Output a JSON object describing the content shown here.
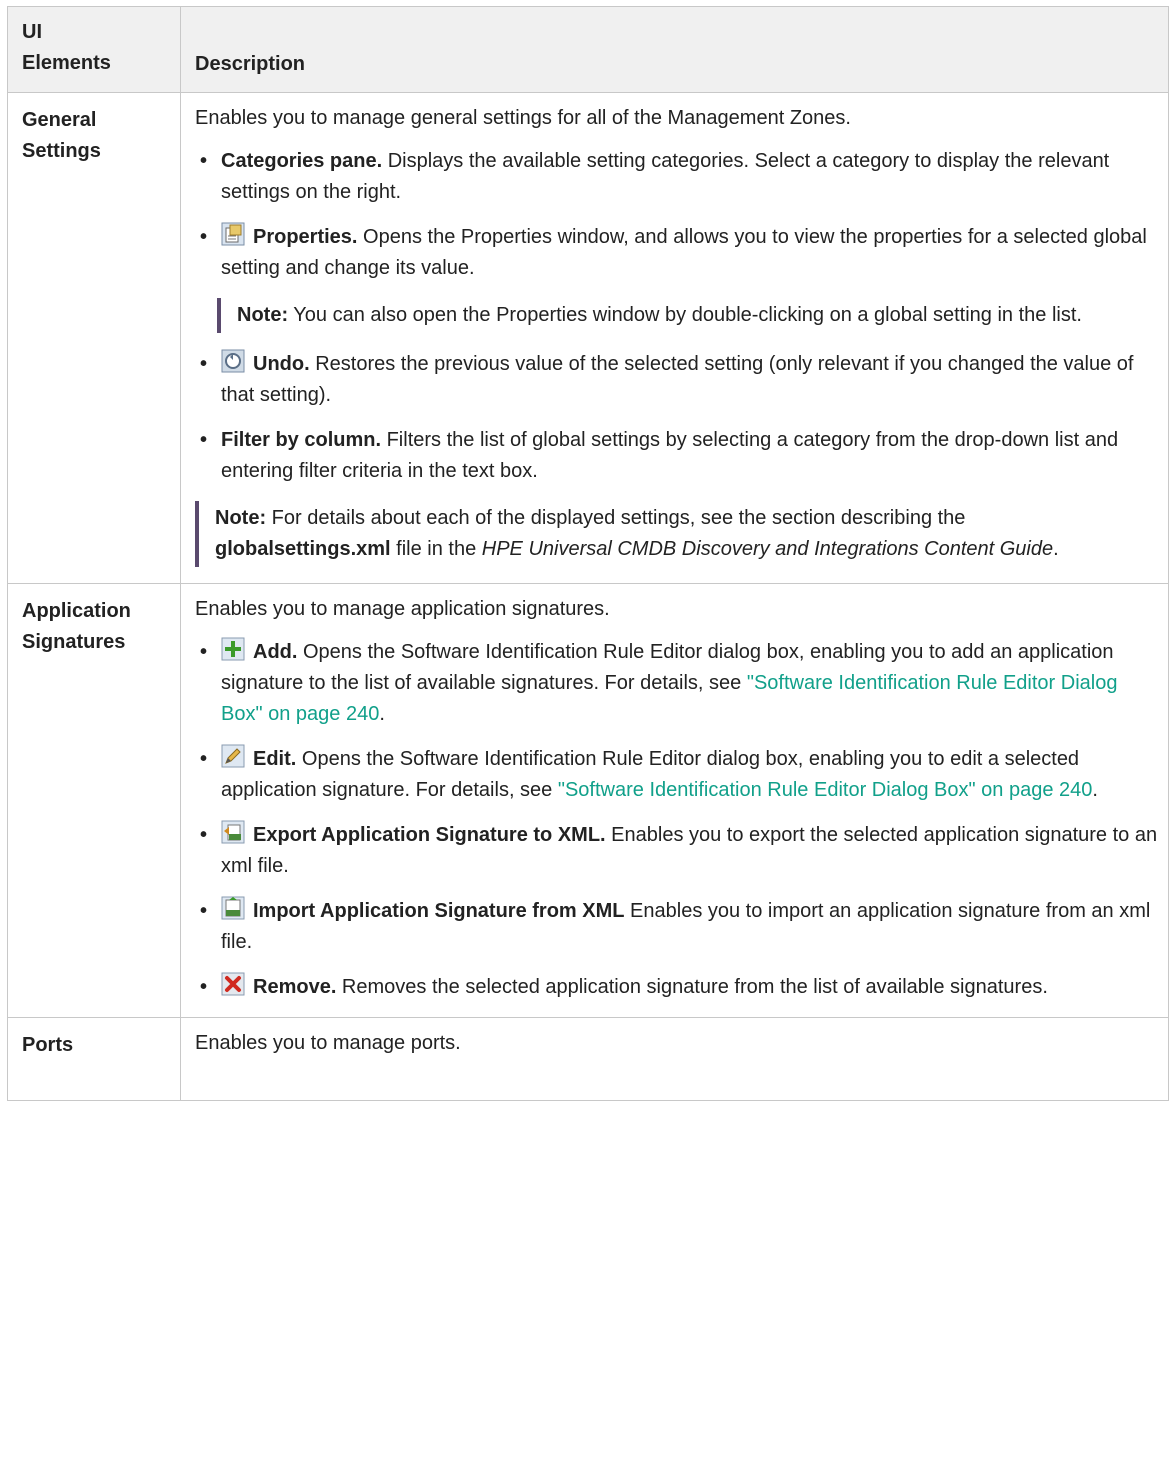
{
  "header": {
    "col1_line1": "UI",
    "col1_line2": "Elements",
    "col2": "Description"
  },
  "general": {
    "label_line1": "General",
    "label_line2": "Settings",
    "intro": "Enables you to manage general settings for all of the Management Zones.",
    "categories": {
      "bold": "Categories pane.",
      "text": " Displays the available setting categories. Select a category to display the relevant settings on the right."
    },
    "properties": {
      "bold": "Properties.",
      "text": " Opens the Properties window, and allows you to view the properties for a selected global setting and change its value."
    },
    "properties_note": {
      "bold": "Note:",
      "text": "  You can also open the Properties window by double-clicking on a global setting in the list."
    },
    "undo": {
      "bold": "Undo.",
      "text": " Restores the previous value of the selected setting (only relevant if you changed the value of that setting)."
    },
    "filter": {
      "bold": "Filter by column.",
      "text": " Filters the list of global settings by selecting a category from the drop-down list and entering filter criteria in the text box."
    },
    "note": {
      "bold": "Note:",
      "t1": "  For details about each of the displayed settings, see the section describing the ",
      "file": "globalsettings.xml",
      "t2": " file in the ",
      "guide": "HPE Universal CMDB Discovery and Integrations Content Guide",
      "t3": "."
    }
  },
  "signatures": {
    "label_line1": "Application",
    "label_line2": "Signatures",
    "intro": "Enables you to manage application signatures.",
    "add": {
      "bold": "Add.",
      "text": " Opens the Software Identification Rule Editor dialog box, enabling you to add an application signature to the list of available signatures. For details, see ",
      "link": "\"Software Identification Rule Editor Dialog Box\" on page 240",
      "end": "."
    },
    "edit": {
      "bold": "Edit.",
      "text": " Opens the Software Identification Rule Editor dialog box, enabling you to edit a selected application signature. For details, see ",
      "link": "\"Software Identification Rule Editor Dialog Box\" on page 240",
      "end": "."
    },
    "export": {
      "bold": "Export Application Signature to XML.",
      "text": " Enables you to export the selected application signature to an xml file."
    },
    "import": {
      "bold": "Import Application Signature from XML",
      "text": " Enables you to import an application signature from an xml file."
    },
    "remove": {
      "bold": "Remove.",
      "text": " Removes the selected application signature from the list of available signatures."
    }
  },
  "ports": {
    "label": "Ports",
    "intro": "Enables you to manage ports."
  },
  "colors": {
    "link": "#11a08a",
    "header_bg": "#f0f0f0",
    "note_bar": "#5a4a6e"
  }
}
